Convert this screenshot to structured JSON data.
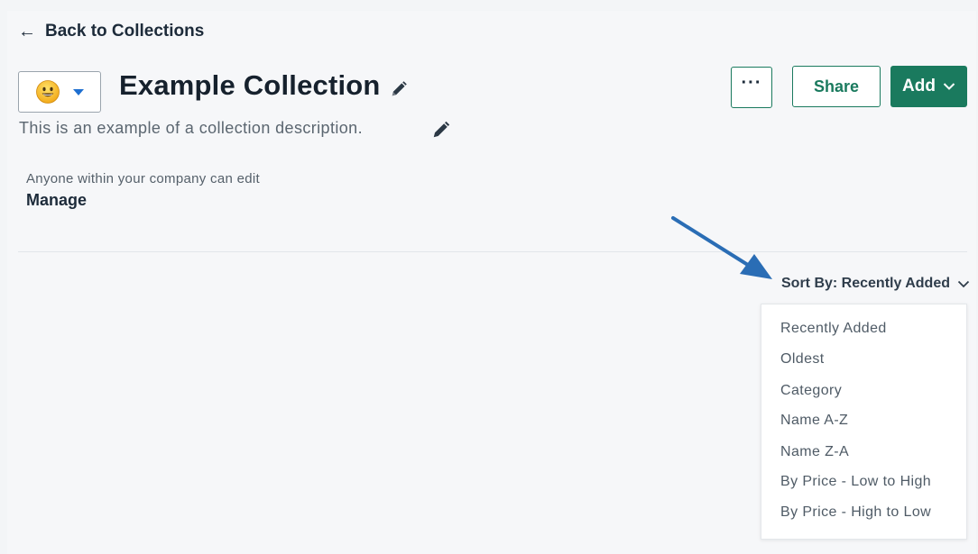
{
  "nav": {
    "back_label": "Back to Collections"
  },
  "collection": {
    "title": "Example Collection",
    "description": "This is an example of a collection description.",
    "permission_text": "Anyone within your company can edit",
    "manage_label": "Manage"
  },
  "toolbar": {
    "more_label": "···",
    "share_label": "Share",
    "add_label": "Add"
  },
  "sort": {
    "label": "Sort By: Recently Added",
    "options": [
      "Recently Added",
      "Oldest",
      "Category",
      "Name A-Z",
      "Name Z-A",
      "By Price - Low to High",
      "By Price - High to Low"
    ]
  },
  "icons": {
    "back": "arrow-left-icon",
    "emoji": "smiley-face-icon",
    "emoji_caret": "caret-down-icon",
    "edit": "pencil-icon",
    "more": "ellipsis-icon",
    "add_caret": "chevron-down-icon",
    "sort_caret": "chevron-down-icon",
    "annotation": "annotation-arrow"
  },
  "colors": {
    "primary": "#1a7a5e",
    "emoji_caret": "#1e6fd0",
    "annotation_arrow": "#2a6db5",
    "text_dark": "#1d2b3a"
  }
}
